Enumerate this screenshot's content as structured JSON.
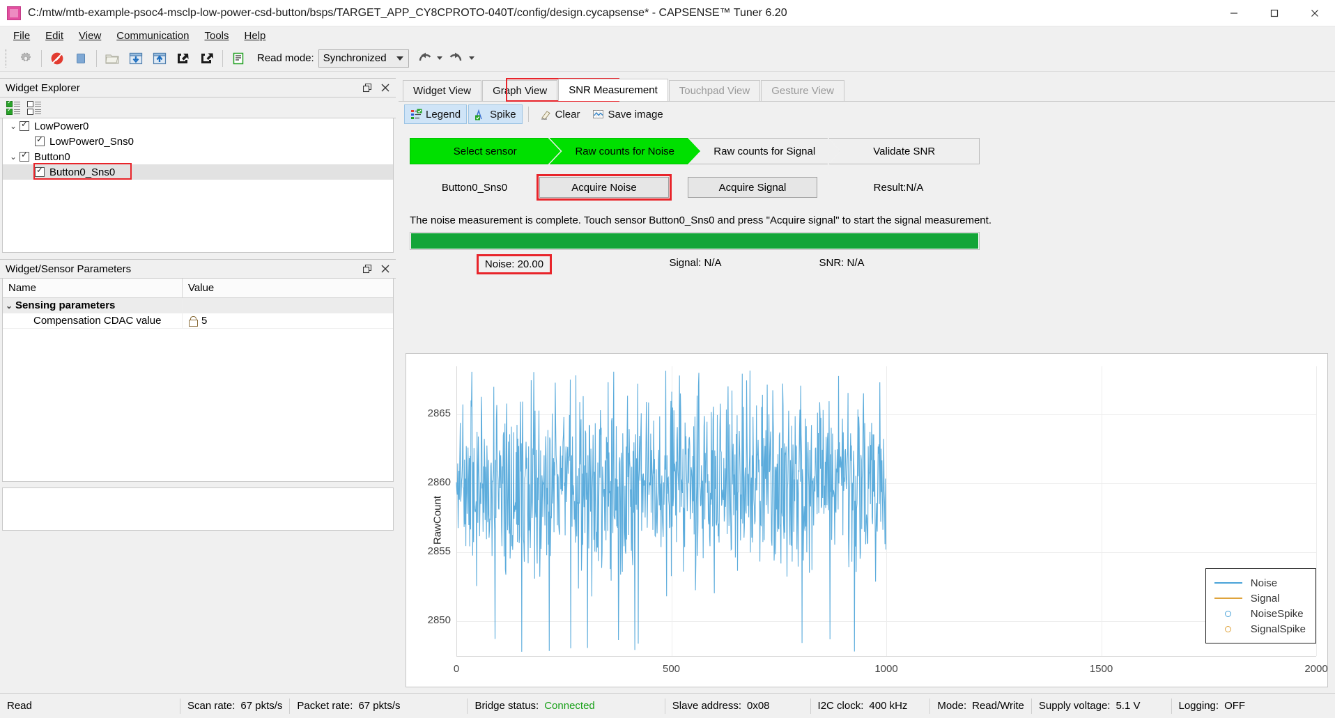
{
  "window": {
    "title": "C:/mtw/mtb-example-psoc4-msclp-low-power-csd-button/bsps/TARGET_APP_CY8CPROTO-040T/config/design.cycapsense* - CAPSENSE™ Tuner 6.20",
    "minimize": "—",
    "maximize": "□",
    "close": "✕"
  },
  "menu": {
    "items": [
      "File",
      "Edit",
      "View",
      "Communication",
      "Tools",
      "Help"
    ]
  },
  "toolbar": {
    "read_mode_label": "Read mode:",
    "read_mode_value": "Synchronized",
    "icons": [
      "gear-icon",
      "disconnect-icon",
      "stop-icon",
      "open-file-icon",
      "apply-to-device-icon",
      "apply-to-project-icon",
      "import-icon",
      "export-icon",
      "log-icon"
    ],
    "undo": "undo-icon",
    "redo": "redo-icon"
  },
  "widget_explorer": {
    "title": "Widget Explorer",
    "float_icon": "restore-icon",
    "close_icon": "close-icon",
    "check_all": "check-all-icon",
    "uncheck_all": "uncheck-all-icon",
    "tree": [
      {
        "label": "LowPower0",
        "level": 0,
        "expanded": true,
        "checked": true,
        "selected": false
      },
      {
        "label": "LowPower0_Sns0",
        "level": 1,
        "expanded": false,
        "checked": true,
        "selected": false
      },
      {
        "label": "Button0",
        "level": 0,
        "expanded": true,
        "checked": true,
        "selected": false
      },
      {
        "label": "Button0_Sns0",
        "level": 1,
        "expanded": false,
        "checked": true,
        "selected": true,
        "highlighted": true
      }
    ]
  },
  "parameters": {
    "title": "Widget/Sensor Parameters",
    "float_icon": "restore-icon",
    "close_icon": "close-icon",
    "columns": [
      "Name",
      "Value"
    ],
    "rows": [
      {
        "name": "Sensing parameters",
        "value": "",
        "group": true
      },
      {
        "name": "Compensation CDAC value",
        "value": "5",
        "locked": true
      }
    ]
  },
  "tabs": [
    {
      "label": "Widget View",
      "active": false,
      "disabled": false
    },
    {
      "label": "Graph View",
      "active": false,
      "disabled": false
    },
    {
      "label": "SNR Measurement",
      "active": true,
      "disabled": false,
      "highlighted": true
    },
    {
      "label": "Touchpad View",
      "active": false,
      "disabled": true
    },
    {
      "label": "Gesture View",
      "active": false,
      "disabled": true
    }
  ],
  "view_toolbar": [
    {
      "label": "Legend",
      "icon": "legend-icon",
      "toggled": true
    },
    {
      "label": "Spike",
      "icon": "spike-icon",
      "toggled": true
    },
    {
      "label": "Clear",
      "icon": "eraser-icon",
      "toggled": false
    },
    {
      "label": "Save image",
      "icon": "save-image-icon",
      "toggled": false
    }
  ],
  "snr": {
    "steps": [
      {
        "label": "Select sensor",
        "state": "done"
      },
      {
        "label": "Raw counts for Noise",
        "state": "done"
      },
      {
        "label": "Raw counts for Signal",
        "state": "pending"
      },
      {
        "label": "Validate SNR",
        "state": "pending"
      }
    ],
    "sensor_name": "Button0_Sns0",
    "acquire_noise_label": "Acquire Noise",
    "acquire_signal_label": "Acquire Signal",
    "result_label": "Result:N/A",
    "status_message": "The noise measurement is complete. Touch sensor Button0_Sns0 and press \"Acquire signal\" to start the signal measurement.",
    "progress_percent": 100,
    "noise_label": "Noise:",
    "noise_value": "20.00",
    "signal_label": "Signal:",
    "signal_value": "N/A",
    "snr_label": "SNR:",
    "snr_value": "N/A"
  },
  "chart_data": {
    "type": "line",
    "title": "",
    "xlabel": "",
    "ylabel": "RawCount",
    "xlim": [
      0,
      2000
    ],
    "ylim": [
      2847.5,
      2868.5
    ],
    "xticks": [
      0,
      500,
      1000,
      1500,
      2000
    ],
    "yticks": [
      2850,
      2855,
      2860,
      2865
    ],
    "grid": true,
    "legend_position": "bottom-right",
    "series": [
      {
        "name": "Noise",
        "color": "#4aa3d8",
        "style": "line",
        "n_points": 1000,
        "mean": 2859.6,
        "min": 2847.8,
        "max": 2868.2,
        "peak_to_peak": 20.0
      },
      {
        "name": "Signal",
        "color": "#dfa33c",
        "style": "line",
        "n_points": 0
      },
      {
        "name": "NoiseSpike",
        "color": "#4aa3d8",
        "style": "marker",
        "n_points": 0
      },
      {
        "name": "SignalSpike",
        "color": "#dfa33c",
        "style": "marker",
        "n_points": 0
      }
    ]
  },
  "statusbar": {
    "state": "Read",
    "scan_rate_label": "Scan rate:",
    "scan_rate_value": "67 pkts/s",
    "packet_rate_label": "Packet rate:",
    "packet_rate_value": "67 pkts/s",
    "bridge_status_label": "Bridge status:",
    "bridge_status_value": "Connected",
    "slave_address_label": "Slave address:",
    "slave_address_value": "0x08",
    "i2c_clock_label": "I2C clock:",
    "i2c_clock_value": "400 kHz",
    "mode_label": "Mode:",
    "mode_value": "Read/Write",
    "supply_voltage_label": "Supply voltage:",
    "supply_voltage_value": "5.1 V",
    "logging_label": "Logging:",
    "logging_value": "OFF"
  },
  "colors": {
    "accent_green": "#00e000",
    "progress_green": "#13a538",
    "noise_blue": "#4aa3d8",
    "signal_orange": "#dfa33c",
    "highlight_red": "#e8242a"
  }
}
